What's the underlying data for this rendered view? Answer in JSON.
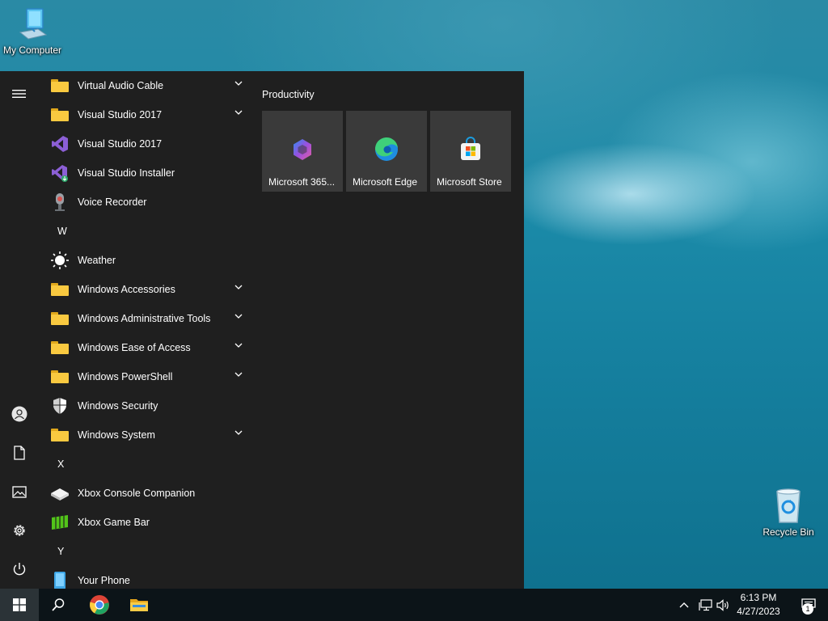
{
  "desktop": {
    "icons": [
      {
        "label": "My Computer"
      },
      {
        "label": "Recycle Bin"
      }
    ]
  },
  "start_menu": {
    "apps": [
      {
        "type": "app",
        "label": "Virtual Audio Cable",
        "icon": "folder-icon",
        "expandable": true
      },
      {
        "type": "app",
        "label": "Visual Studio 2017",
        "icon": "folder-icon",
        "expandable": true
      },
      {
        "type": "app",
        "label": "Visual Studio 2017",
        "icon": "visual-studio-icon",
        "expandable": false
      },
      {
        "type": "app",
        "label": "Visual Studio Installer",
        "icon": "visual-studio-installer-icon",
        "expandable": false
      },
      {
        "type": "app",
        "label": "Voice Recorder",
        "icon": "microphone-icon",
        "expandable": false
      },
      {
        "type": "letter",
        "label": "W"
      },
      {
        "type": "app",
        "label": "Weather",
        "icon": "sun-icon",
        "expandable": false
      },
      {
        "type": "app",
        "label": "Windows Accessories",
        "icon": "folder-icon",
        "expandable": true
      },
      {
        "type": "app",
        "label": "Windows Administrative Tools",
        "icon": "folder-icon",
        "expandable": true
      },
      {
        "type": "app",
        "label": "Windows Ease of Access",
        "icon": "folder-icon",
        "expandable": true
      },
      {
        "type": "app",
        "label": "Windows PowerShell",
        "icon": "folder-icon",
        "expandable": true
      },
      {
        "type": "app",
        "label": "Windows Security",
        "icon": "shield-icon",
        "expandable": false
      },
      {
        "type": "app",
        "label": "Windows System",
        "icon": "folder-icon",
        "expandable": true
      },
      {
        "type": "letter",
        "label": "X"
      },
      {
        "type": "app",
        "label": "Xbox Console Companion",
        "icon": "xbox-controller-icon",
        "expandable": false
      },
      {
        "type": "app",
        "label": "Xbox Game Bar",
        "icon": "xbox-game-bar-icon",
        "expandable": false
      },
      {
        "type": "letter",
        "label": "Y"
      },
      {
        "type": "app",
        "label": "Your Phone",
        "icon": "phone-icon",
        "expandable": false
      }
    ],
    "tile_group": "Productivity",
    "tiles": [
      {
        "label": "Microsoft 365...",
        "icon": "microsoft-365-icon"
      },
      {
        "label": "Microsoft Edge",
        "icon": "edge-icon"
      },
      {
        "label": "Microsoft Store",
        "icon": "store-icon"
      }
    ],
    "rail": [
      "menu-icon",
      "user-icon",
      "documents-icon",
      "pictures-icon",
      "settings-icon",
      "power-icon"
    ]
  },
  "taskbar": {
    "time": "6:13 PM",
    "date": "4/27/2023",
    "notification_count": "1"
  }
}
